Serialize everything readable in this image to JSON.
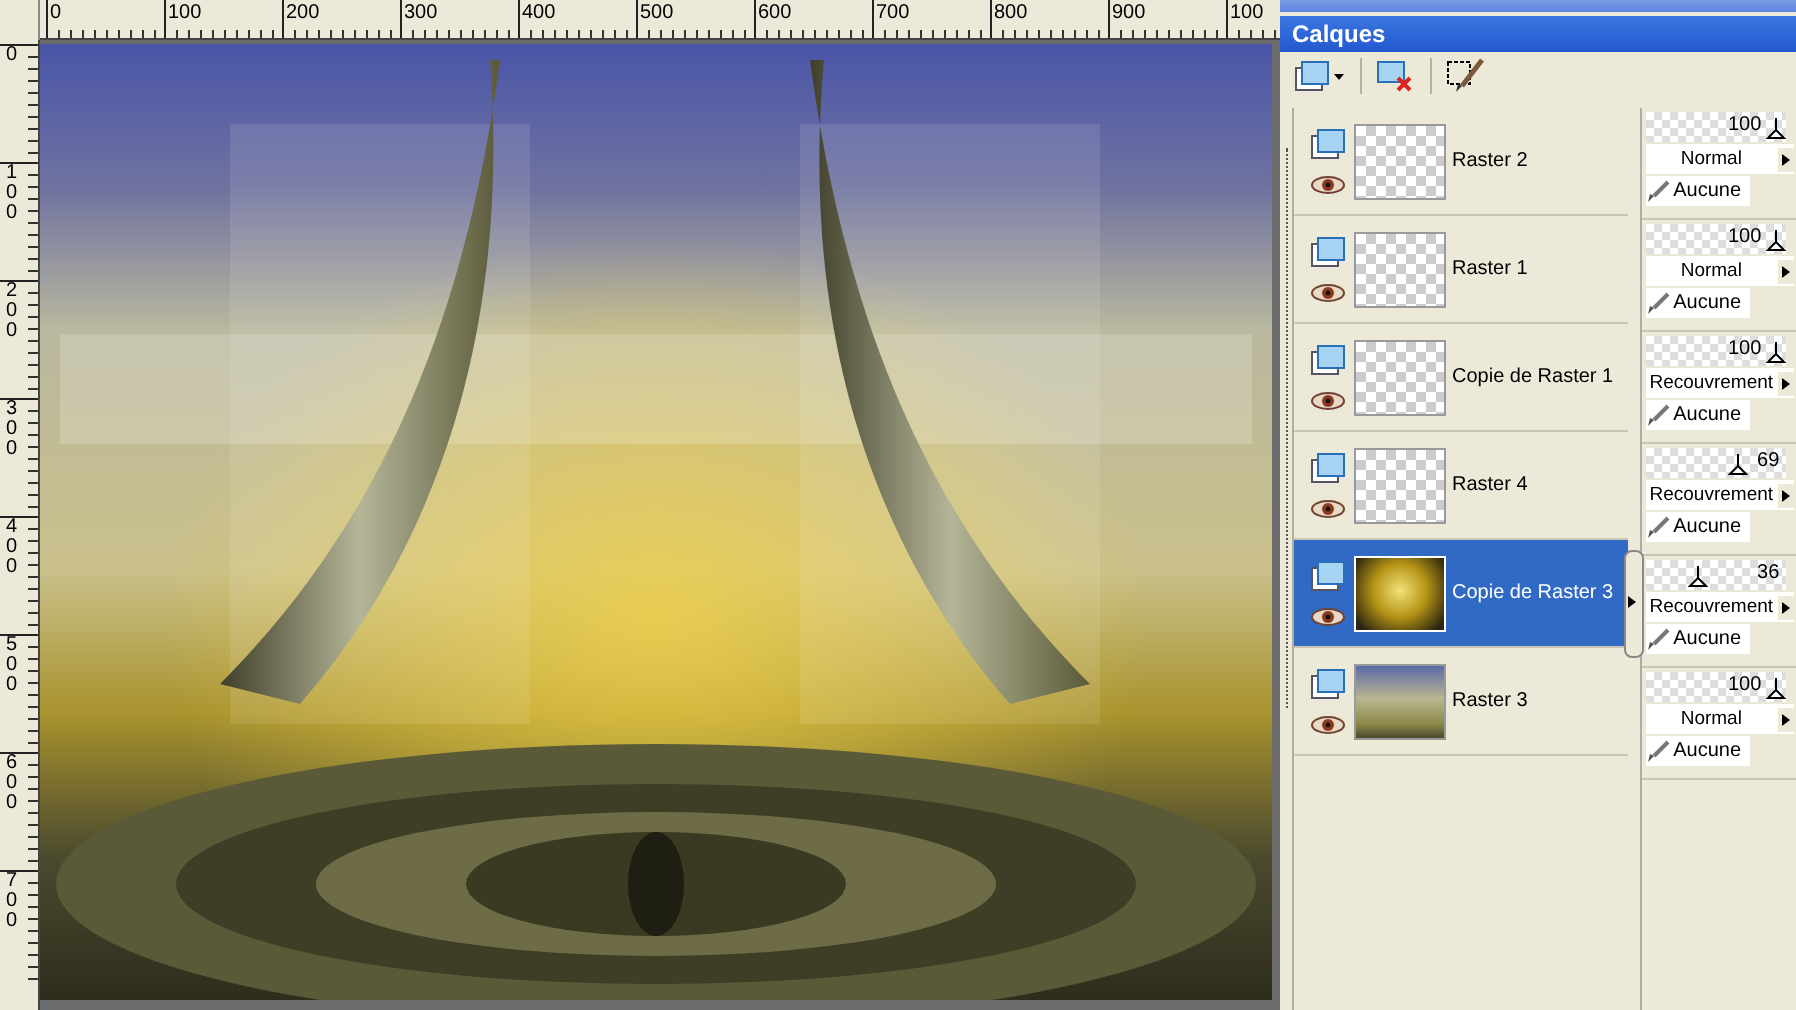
{
  "rulers": {
    "horizontal": [
      "0",
      "100",
      "200",
      "300",
      "400",
      "500",
      "600",
      "700",
      "800",
      "900",
      "100"
    ],
    "vertical": [
      "0",
      "100",
      "200",
      "300",
      "400",
      "500",
      "600",
      "700"
    ]
  },
  "layers_palette": {
    "title": "Calques",
    "layers": [
      {
        "name": "Raster 2",
        "selected": false,
        "kind": "transparent",
        "opacity": "100",
        "level": 1,
        "blend_mode": "Normal",
        "mask": "Aucune"
      },
      {
        "name": "Raster 1",
        "selected": false,
        "kind": "transparent",
        "opacity": "100",
        "level": 1,
        "blend_mode": "Normal",
        "mask": "Aucune"
      },
      {
        "name": "Copie de Raster 1",
        "selected": false,
        "kind": "transparent",
        "opacity": "100",
        "level": 1,
        "blend_mode": "Recouvrement",
        "mask": "Aucune"
      },
      {
        "name": "Raster 4",
        "selected": false,
        "kind": "transparent",
        "opacity": "69",
        "level": 0.69,
        "blend_mode": "Recouvrement",
        "mask": "Aucune"
      },
      {
        "name": "Copie de Raster 3",
        "selected": true,
        "kind": "gradient",
        "opacity": "36",
        "level": 0.36,
        "blend_mode": "Recouvrement",
        "mask": "Aucune"
      },
      {
        "name": "Raster 3",
        "selected": false,
        "kind": "image",
        "opacity": "100",
        "level": 1,
        "blend_mode": "Normal",
        "mask": "Aucune"
      }
    ]
  }
}
